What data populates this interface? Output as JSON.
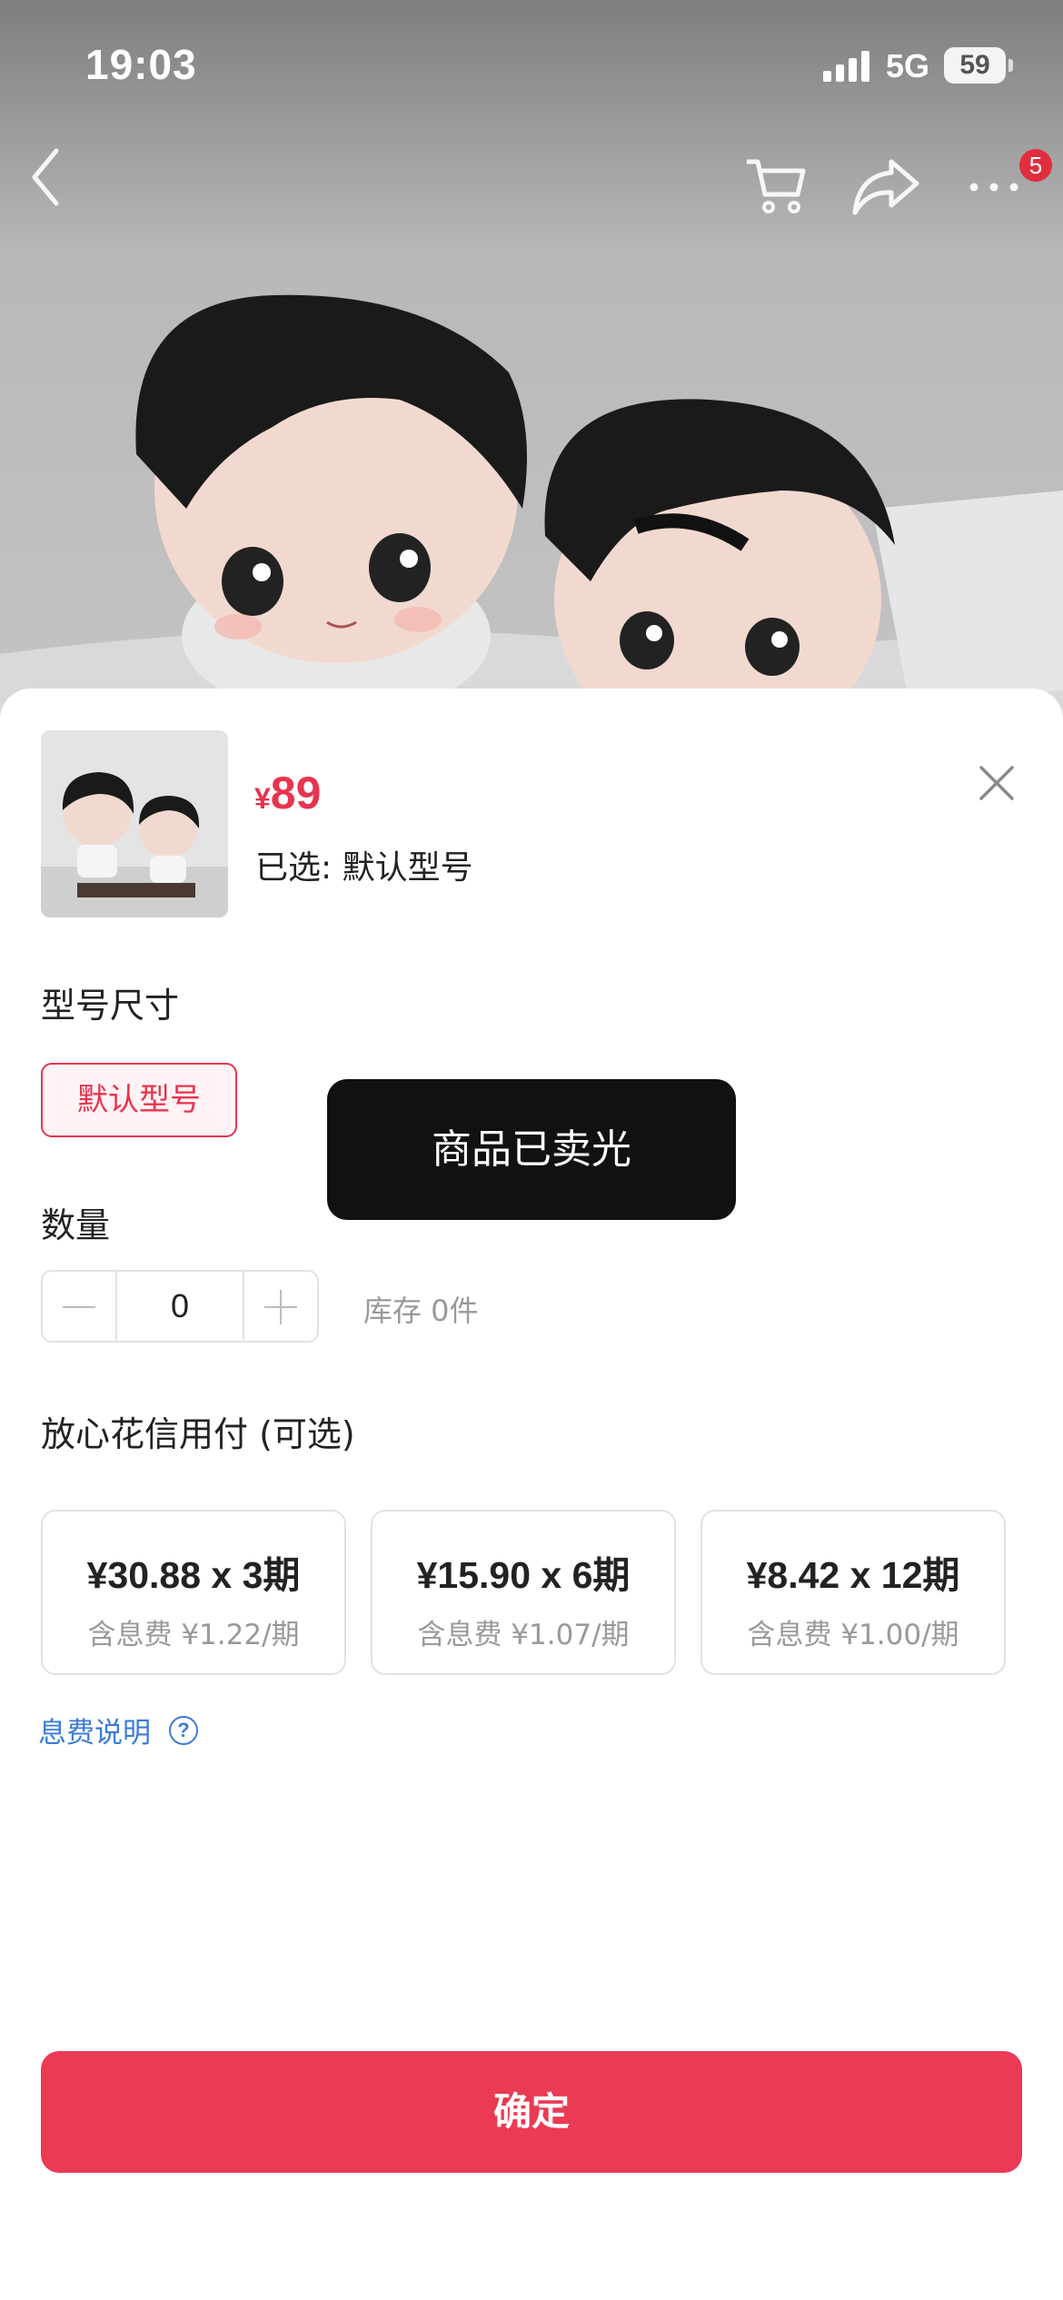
{
  "status_bar": {
    "time": "19:03",
    "network": "5G",
    "battery": "59"
  },
  "nav": {
    "cart_badge": "5"
  },
  "sheet": {
    "currency": "¥",
    "price": "89",
    "selected_text": "已选: 默认型号",
    "spec_title": "型号尺寸",
    "variant_label": "默认型号",
    "quantity_title": "数量",
    "quantity_value": "0",
    "stock_text": "库存 0件",
    "credit_title": "放心花信用付 (可选)",
    "plans": [
      {
        "main": "¥30.88 x 3期",
        "sub": "含息费 ¥1.22/期"
      },
      {
        "main": "¥15.90 x 6期",
        "sub": "含息费 ¥1.07/期"
      },
      {
        "main": "¥8.42 x 12期",
        "sub": "含息费 ¥1.00/期"
      }
    ],
    "fee_link": "息费说明",
    "confirm_label": "确定"
  },
  "toast": {
    "message": "商品已卖光"
  },
  "colors": {
    "accent": "#ea3a54",
    "price": "#e8344e",
    "link": "#3b7bd8",
    "toast_bg": "#111111"
  }
}
